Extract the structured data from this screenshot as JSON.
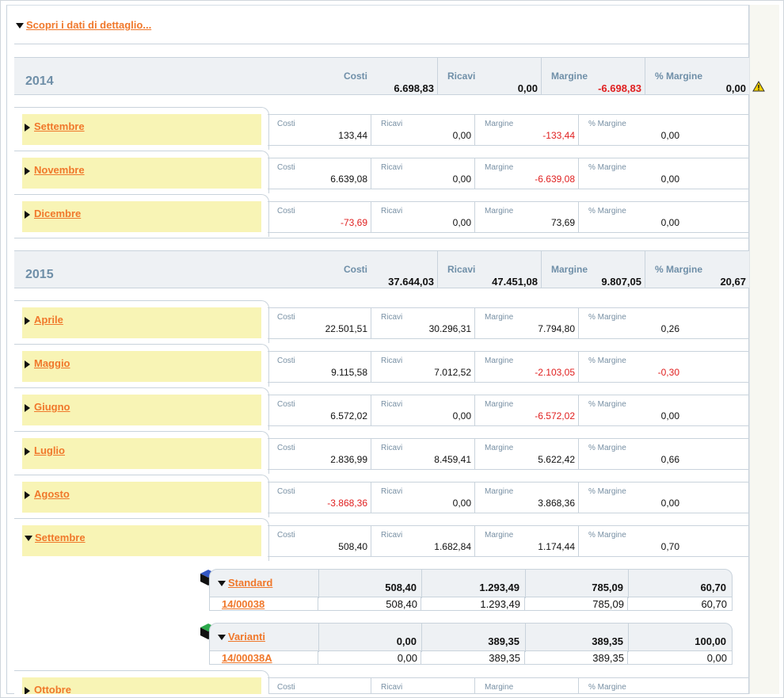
{
  "header": {
    "toggle_label": "Scopri i dati di dettaglio..."
  },
  "labels": {
    "costi": "Costi",
    "ricavi": "Ricavi",
    "margine": "Margine",
    "pct_margine": "% Margine"
  },
  "years": [
    {
      "year": "2014",
      "costi": "6.698,83",
      "ricavi": "0,00",
      "margine": "-6.698,83",
      "pct": "0,00",
      "months": [
        {
          "name": "Settembre",
          "costi": "133,44",
          "ricavi": "0,00",
          "margine": "-133,44",
          "pct": "0,00"
        },
        {
          "name": "Novembre",
          "costi": "6.639,08",
          "ricavi": "0,00",
          "margine": "-6.639,08",
          "pct": "0,00"
        },
        {
          "name": "Dicembre",
          "costi": "-73,69",
          "ricavi": "0,00",
          "margine": "73,69",
          "pct": "0,00"
        }
      ]
    },
    {
      "year": "2015",
      "costi": "37.644,03",
      "ricavi": "47.451,08",
      "margine": "9.807,05",
      "pct": "20,67",
      "months": [
        {
          "name": "Aprile",
          "costi": "22.501,51",
          "ricavi": "30.296,31",
          "margine": "7.794,80",
          "pct": "0,26"
        },
        {
          "name": "Maggio",
          "costi": "9.115,58",
          "ricavi": "7.012,52",
          "margine": "-2.103,05",
          "pct": "-0,30"
        },
        {
          "name": "Giugno",
          "costi": "6.572,02",
          "ricavi": "0,00",
          "margine": "-6.572,02",
          "pct": "0,00"
        },
        {
          "name": "Luglio",
          "costi": "2.836,99",
          "ricavi": "8.459,41",
          "margine": "5.622,42",
          "pct": "0,66"
        },
        {
          "name": "Agosto",
          "costi": "-3.868,36",
          "ricavi": "0,00",
          "margine": "3.868,36",
          "pct": "0,00"
        },
        {
          "name": "Settembre",
          "costi": "508,40",
          "ricavi": "1.682,84",
          "margine": "1.174,44",
          "pct": "0,70"
        },
        {
          "name": "Ottobre",
          "costi": "",
          "ricavi": "",
          "margine": "",
          "pct": ""
        }
      ]
    }
  ],
  "sub_settembre_2015": [
    {
      "name": "Standard",
      "cube_color": "#1c3b8a",
      "costi": "508,40",
      "ricavi": "1.293,49",
      "margine": "785,09",
      "pct": "60,70",
      "row": {
        "code": "14/00038",
        "costi": "508,40",
        "ricavi": "1.293,49",
        "margine": "785,09",
        "pct": "60,70"
      }
    },
    {
      "name": "Varianti",
      "cube_color": "#1e8a3a",
      "costi": "0,00",
      "ricavi": "389,35",
      "margine": "389,35",
      "pct": "100,00",
      "row": {
        "code": "14/00038A",
        "costi": "0,00",
        "ricavi": "389,35",
        "margine": "389,35",
        "pct": "0,00"
      }
    }
  ],
  "colors": {
    "link": "#f0782b",
    "negative": "#e02020",
    "month_bg": "#f8f4b5",
    "year_label": "#6f8fa8"
  }
}
